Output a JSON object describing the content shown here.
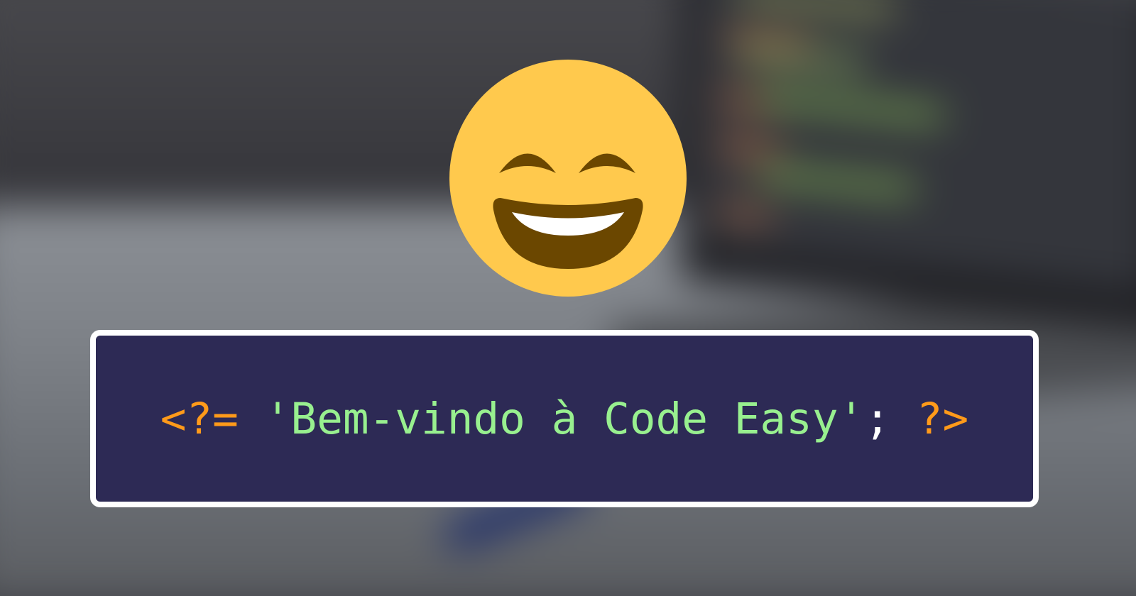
{
  "background": {
    "description_icon": "blurred-laptop-photo",
    "colors": {
      "desk": "#7d8187",
      "wall": "#3a3a3f",
      "code_green": "#8fd06a",
      "code_orange": "#e08a3a"
    }
  },
  "emoji": {
    "icon": "grinning-face-with-smiling-eyes-icon",
    "color": "#ffc94d",
    "feature_color": "#6b4700"
  },
  "code_box": {
    "open_tag": "<?=",
    "string": "'Bem-vindo à Code Easy'",
    "semicolon": ";",
    "close_tag": "?>",
    "colors": {
      "background": "#2d2a55",
      "border": "#ffffff",
      "tag": "#ff9a1a",
      "string": "#98f08f",
      "punctuation": "#ffffff"
    }
  }
}
